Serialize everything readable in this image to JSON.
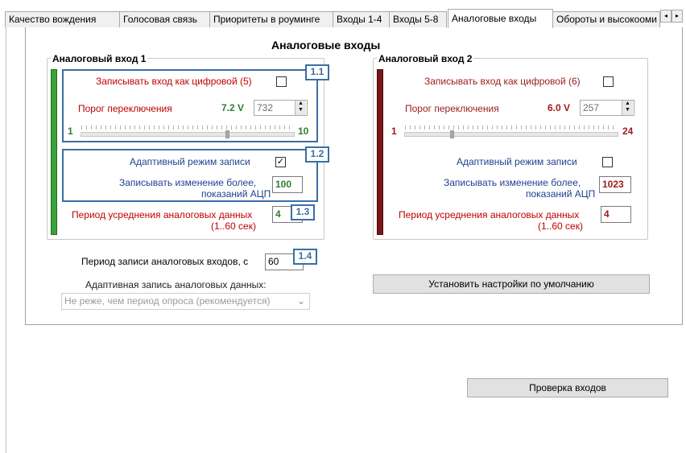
{
  "tabs": [
    "Качество вождения",
    "Голосовая связь",
    "Приоритеты в роуминге",
    "Входы 1-4",
    "Входы 5-8",
    "Аналоговые входы",
    "Обороты и высокооми"
  ],
  "page_title": "Аналоговые входы",
  "input1": {
    "title": "Аналоговый вход 1",
    "record_digital_label": "Записывать вход как цифровой (5)",
    "record_digital_checked": false,
    "threshold_label": "Порог переключения",
    "threshold_voltage": "7.2 V",
    "threshold_value": "732",
    "slider_min": "1",
    "slider_max": "10",
    "adaptive_label": "Адаптивный режим записи",
    "adaptive_checked": true,
    "adaptive_checked_glyph": "✓",
    "change_label_1": "Записывать изменение более,",
    "change_label_2": "показаний АЦП",
    "change_value": "100",
    "period_label_1": "Период усреднения аналоговых данных",
    "period_label_2": "(1..60 сек)",
    "period_value": "4",
    "accent_color": "#2e7d32"
  },
  "input2": {
    "title": "Аналоговый вход 2",
    "record_digital_label": "Записывать вход как цифровой (6)",
    "record_digital_checked": false,
    "threshold_label": "Порог переключения",
    "threshold_voltage": "6.0 V",
    "threshold_value": "257",
    "slider_min": "1",
    "slider_max": "24",
    "adaptive_label": "Адаптивный режим записи",
    "adaptive_checked": false,
    "change_label_1": "Записывать изменение более,",
    "change_label_2": "показаний АЦП",
    "change_value": "1023",
    "period_label_1": "Период усреднения аналоговых данных",
    "period_label_2": "(1..60 сек)",
    "period_value": "4",
    "accent_color": "#7b1717"
  },
  "badges": {
    "b11": "1.1",
    "b12": "1.2",
    "b13": "1.3",
    "b14": "1.4"
  },
  "record_period_label": "Период записи аналоговых входов, с",
  "record_period_value": "60",
  "adaptive_record_label": "Адаптивная запись аналоговых данных:",
  "adaptive_record_selected": "Не реже, чем период опроса (рекомендуется)",
  "default_button": "Установить настройки по умолчанию",
  "check_button": "Проверка входов",
  "icons": {
    "tab_scroll_left": "◂",
    "tab_scroll_right": "▸",
    "spin_up": "▲",
    "spin_down": "▼",
    "combo_arrow": "⌄"
  }
}
